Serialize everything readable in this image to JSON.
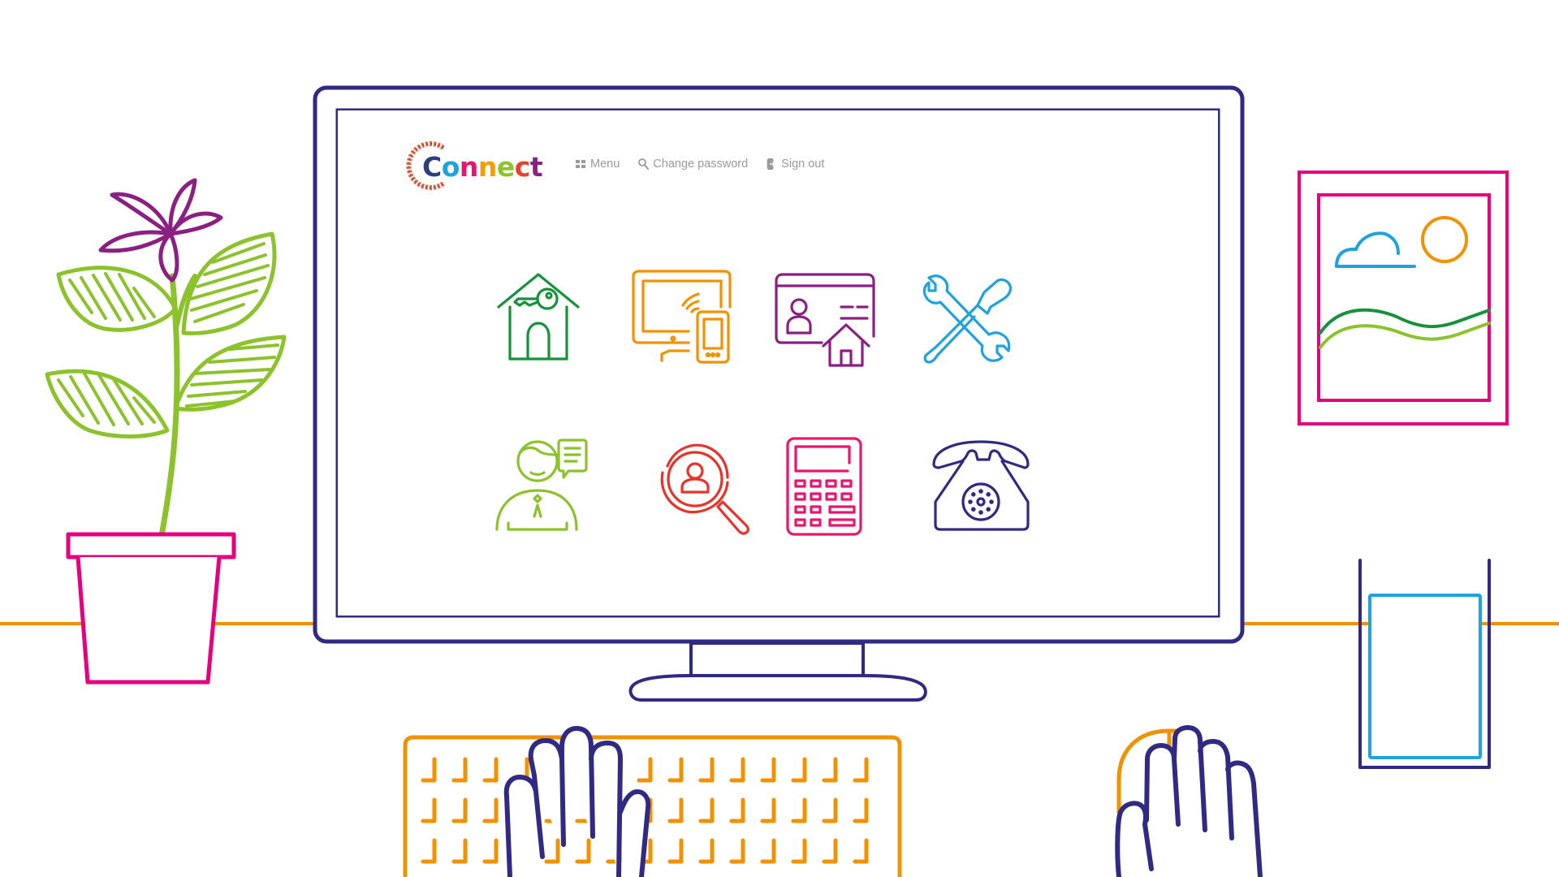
{
  "app": {
    "logo_letters": [
      {
        "ch": "C",
        "color": "#2c3f7c"
      },
      {
        "ch": "o",
        "color": "#1ea3dc"
      },
      {
        "ch": "n",
        "color": "#e5176f"
      },
      {
        "ch": "n",
        "color": "#f0a000"
      },
      {
        "ch": "e",
        "color": "#8cc22c"
      },
      {
        "ch": "c",
        "color": "#e8432d"
      },
      {
        "ch": "t",
        "color": "#8c1f82"
      }
    ],
    "logo_ring_colors": [
      "#e8613b",
      "#2c3f7c"
    ]
  },
  "nav": {
    "menu_label": "Menu",
    "change_password_label": "Change password",
    "sign_out_label": "Sign out"
  },
  "tiles": [
    {
      "name": "housing-key",
      "color": "#16923b"
    },
    {
      "name": "computer-devices",
      "color": "#f39200"
    },
    {
      "name": "id-card-home",
      "color": "#8c1f82"
    },
    {
      "name": "tools-repairs",
      "color": "#1fa2e0"
    },
    {
      "name": "advisor-chat",
      "color": "#8cc22c"
    },
    {
      "name": "person-search",
      "color": "#e8322a"
    },
    {
      "name": "calculator",
      "color": "#e5176f"
    },
    {
      "name": "telephone",
      "color": "#302a84"
    }
  ],
  "colors": {
    "monitor": "#302a84",
    "desk": "#f39200",
    "pot": "#e6007e",
    "flower": "#8c1f82",
    "leaf": "#8cc22c",
    "frame": "#e6007e",
    "cloud": "#1fa2e0",
    "sun": "#f39200",
    "hill_dark": "#16923b",
    "hill_light": "#8cc22c",
    "glass_outer": "#302a84",
    "glass_inner": "#1fa2e0",
    "keyboard": "#f39200",
    "hands": "#302a84",
    "mouse": "#f39200",
    "nav_text": "#9a9a9a"
  }
}
